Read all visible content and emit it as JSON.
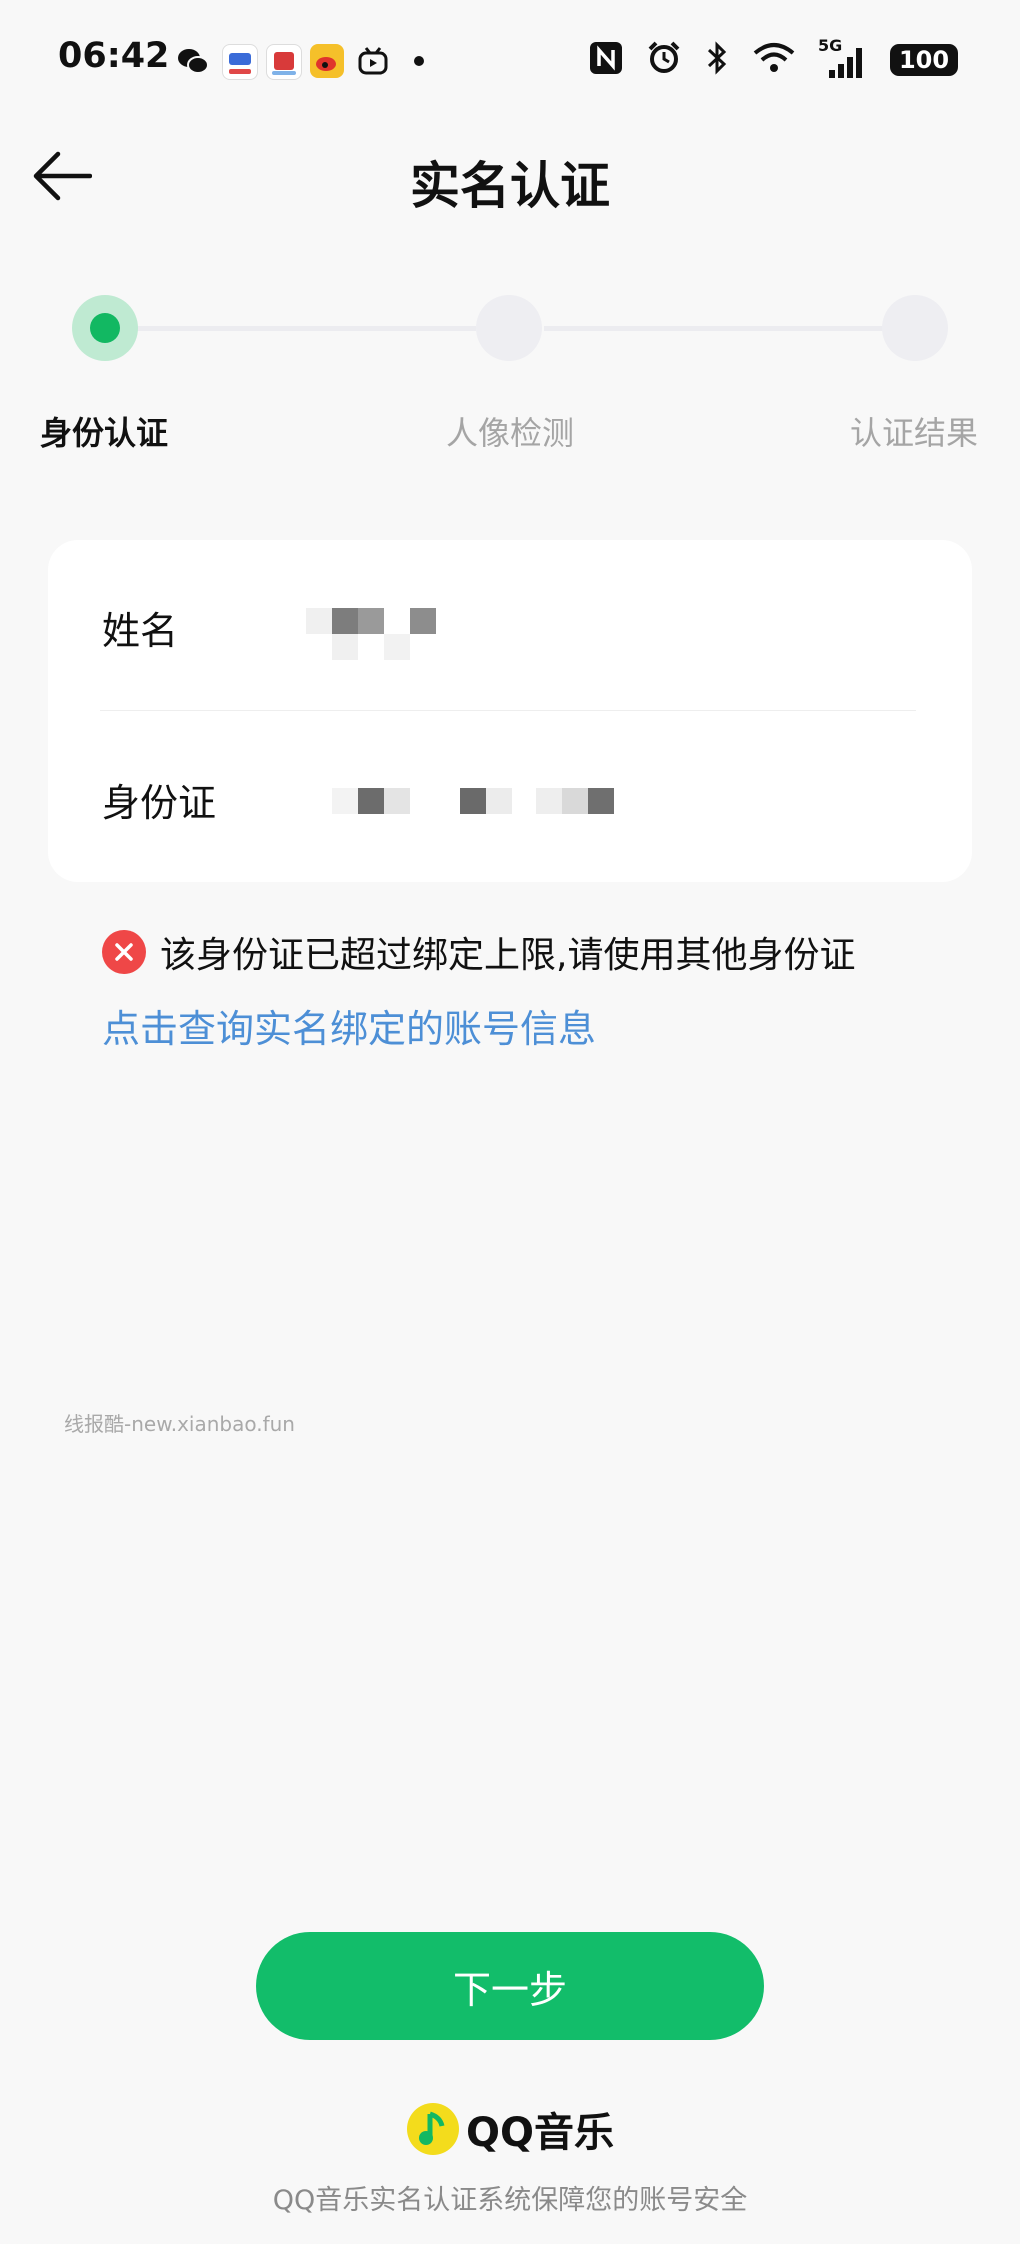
{
  "status_bar": {
    "time": "06:42",
    "app_icons": [
      "wechat-icon",
      "yun-app-icon",
      "pai-app-icon",
      "weibo-icon",
      "bilibili-tv-icon",
      "more-dot-icon"
    ],
    "system_icons": [
      "nfc-icon",
      "alarm-icon",
      "bluetooth-icon",
      "wifi-icon",
      "signal-5g-icon"
    ],
    "network": "5G",
    "battery": "100"
  },
  "header": {
    "title": "实名认证",
    "back_icon": "back-arrow-icon"
  },
  "steps": [
    {
      "label": "身份认证",
      "state": "active"
    },
    {
      "label": "人像检测",
      "state": "pending"
    },
    {
      "label": "认证结果",
      "state": "pending"
    }
  ],
  "form": {
    "name_label": "姓名",
    "id_label": "身份证"
  },
  "error": {
    "message": "该身份证已超过绑定上限,请使用其他身份证",
    "link": "点击查询实名绑定的账号信息"
  },
  "watermark": "线报酷-new.xianbao.fun",
  "next_button": "下一步",
  "brand": {
    "name": "QQ音乐"
  },
  "footer": "QQ音乐实名认证系统保障您的账号安全",
  "colors": {
    "accent_green": "#12bd6a",
    "error_red": "#ef4747",
    "link_blue": "#4d8fd6",
    "background": "#f8f8f8"
  }
}
